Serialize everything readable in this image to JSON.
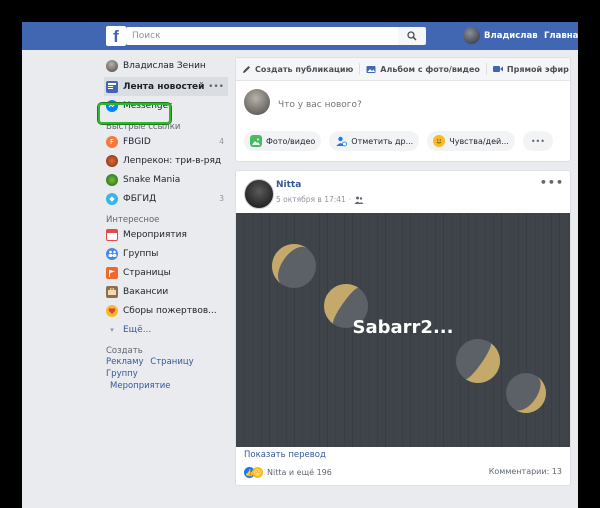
{
  "topbar": {
    "logo": "f",
    "search_placeholder": "Поиск",
    "user_name": "Владислав",
    "home_label": "Главная"
  },
  "sidebar": {
    "profile_name": "Владислав Зенин",
    "feed_label": "Лента новостей",
    "feed_more": "•••",
    "messenger_label": "Messenger",
    "shortcuts_header": "Быстрые ссылки",
    "shortcuts": [
      {
        "label": "FBGID",
        "count": "4"
      },
      {
        "label": "Лепрекон: три-в-ряд",
        "count": ""
      },
      {
        "label": "Snake Mania",
        "count": ""
      },
      {
        "label": "ФБГИД",
        "count": "3"
      }
    ],
    "explore_header": "Интересное",
    "explore": [
      {
        "label": "Мероприятия"
      },
      {
        "label": "Группы"
      },
      {
        "label": "Страницы"
      },
      {
        "label": "Вакансии"
      },
      {
        "label": "Сборы пожертвов..."
      }
    ],
    "more_label": "Ещё...",
    "create_header": "Создать",
    "create_links": [
      "Рекламу",
      "Страницу",
      "Группу",
      "Мероприятие"
    ]
  },
  "composer": {
    "tabs": [
      {
        "label": "Создать публикацию",
        "icon": "pencil-icon"
      },
      {
        "label": "Альбом с фото/видео",
        "icon": "album-icon"
      },
      {
        "label": "Прямой эфир",
        "icon": "video-camera-icon"
      }
    ],
    "placeholder": "Что у вас нового?",
    "actions": [
      {
        "label": "Фото/видео",
        "icon": "photo-icon"
      },
      {
        "label": "Отметить др...",
        "icon": "tag-friends-icon"
      },
      {
        "label": "Чувства/дей...",
        "icon": "smiley-icon"
      }
    ],
    "more": "•••"
  },
  "post": {
    "author": "Nitta",
    "timestamp": "5 октября в 17:41",
    "privacy_icon": "friends-icon",
    "more": "•••",
    "image_text": "Sabarr2...",
    "translate_label": "Показать перевод",
    "reactions_text": "Nitta и ещё 196",
    "comments_text": "Комментарии: 13"
  },
  "colors": {
    "brand": "#4267b2",
    "link": "#365899",
    "highlight": "#2db82d",
    "image_bg": "#3e4449",
    "moon": "#c4a96a"
  }
}
